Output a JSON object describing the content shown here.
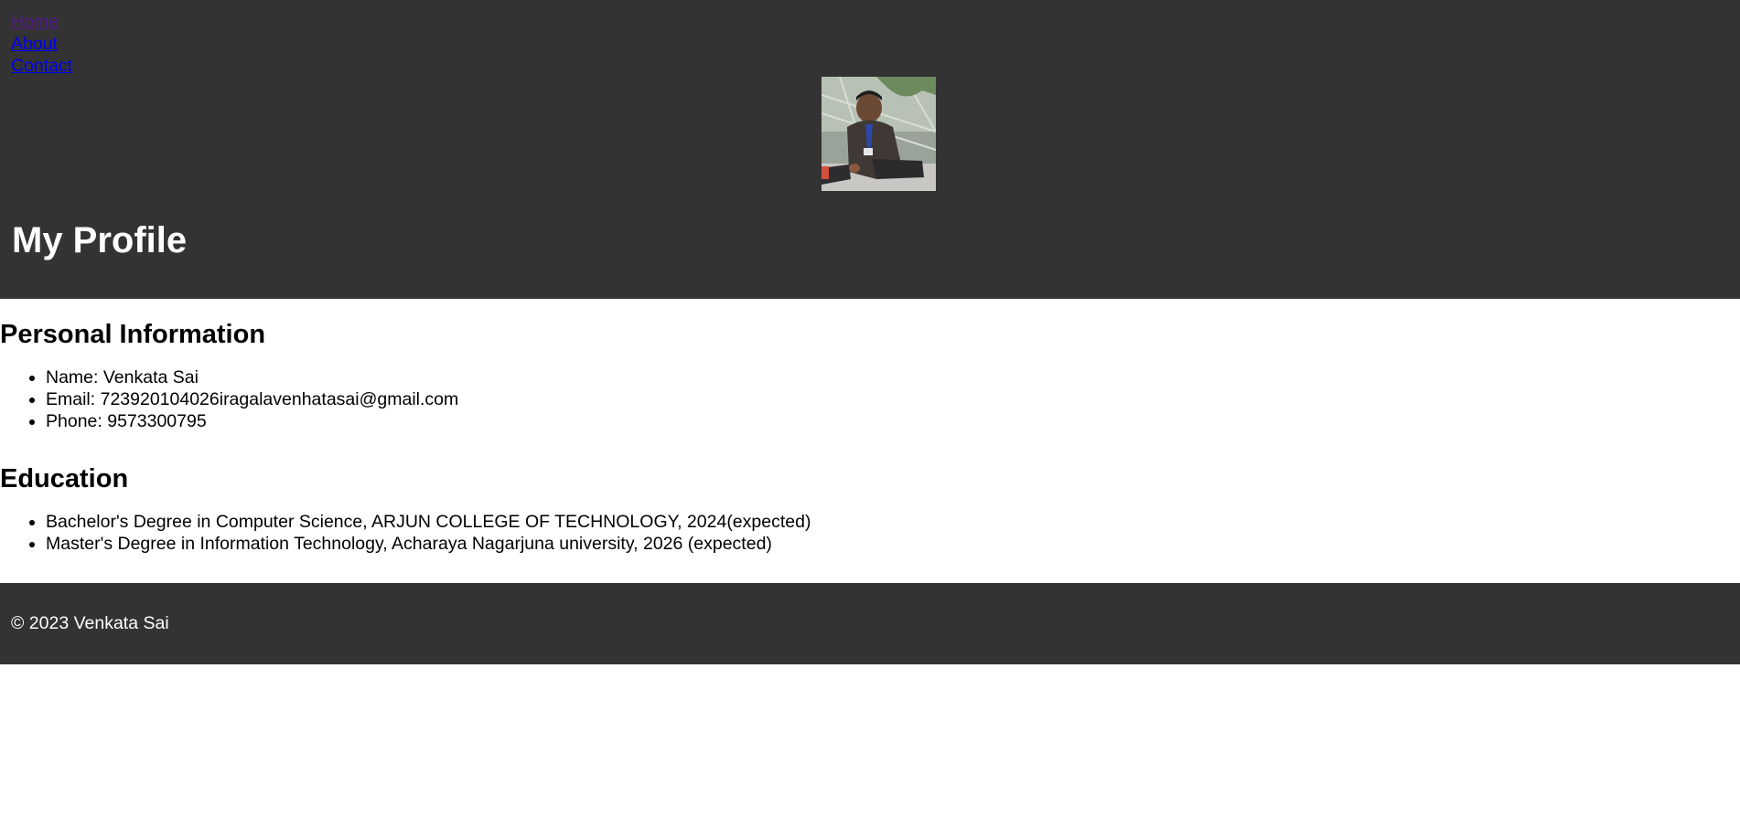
{
  "nav": {
    "links": [
      "Home",
      "About",
      "Contact"
    ]
  },
  "header": {
    "title": "My Profile",
    "avatar_icon": "profile-photo"
  },
  "personal": {
    "heading": "Personal Information",
    "items": [
      "Name: Venkata Sai",
      "Email: 723920104026iragalavenhatasai@gmail.com",
      "Phone: 9573300795"
    ]
  },
  "education": {
    "heading": "Education",
    "items": [
      "Bachelor's Degree in Computer Science, ARJUN COLLEGE OF TECHNOLOGY, 2024(expected)",
      "Master's Degree in Information Technology, Acharaya Nagarjuna university, 2026 (expected)"
    ]
  },
  "footer": {
    "copyright": "© 2023 Venkata Sai"
  },
  "colors": {
    "header_bg": "#333333",
    "footer_bg": "#333333",
    "link": "#0000ee",
    "visited_link": "#551a8b"
  }
}
